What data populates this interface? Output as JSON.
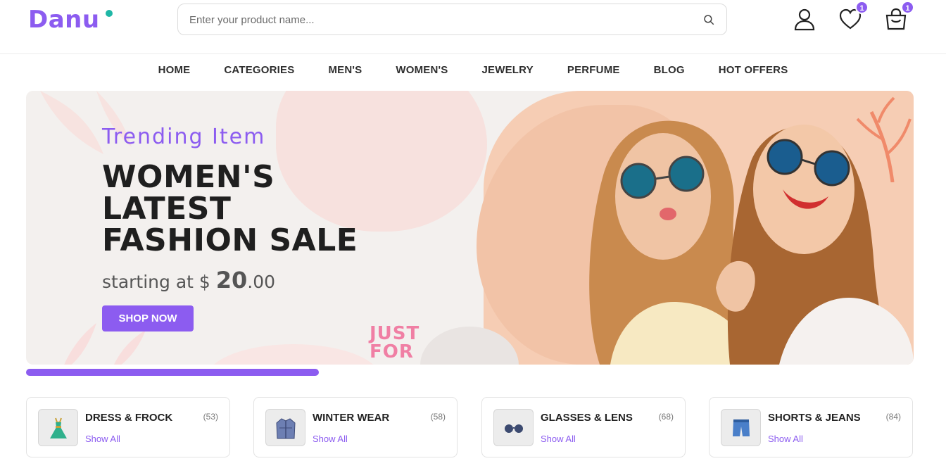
{
  "header": {
    "logo": "Danu",
    "search": {
      "placeholder": "Enter your product name..."
    },
    "wishlist_count": "1",
    "cart_count": "1"
  },
  "nav": [
    "HOME",
    "CATEGORIES",
    "MEN'S",
    "WOMEN'S",
    "JEWELRY",
    "PERFUME",
    "BLOG",
    "HOT OFFERS"
  ],
  "banner": {
    "subtitle": "Trending Item",
    "title_line1": "WOMEN'S",
    "title_line2": "LATEST",
    "title_line3": "FASHION SALE",
    "price_prefix": "starting at $ ",
    "price_whole": "20",
    "price_cents": ".00",
    "button": "SHOP NOW",
    "sticker_line1": "JUST",
    "sticker_line2": "FOR"
  },
  "slider_progress": 0.33,
  "categories": [
    {
      "name": "DRESS & FROCK",
      "count": "(53)",
      "link": "Show All",
      "icon": "dress-icon"
    },
    {
      "name": "WINTER WEAR",
      "count": "(58)",
      "link": "Show All",
      "icon": "jacket-icon"
    },
    {
      "name": "GLASSES & LENS",
      "count": "(68)",
      "link": "Show All",
      "icon": "glasses-icon"
    },
    {
      "name": "SHORTS & JEANS",
      "count": "(84)",
      "link": "Show All",
      "icon": "shorts-icon"
    }
  ],
  "colors": {
    "accent": "#8c5cf0",
    "teal": "#1fb7a6",
    "pink": "#f07fa4"
  }
}
